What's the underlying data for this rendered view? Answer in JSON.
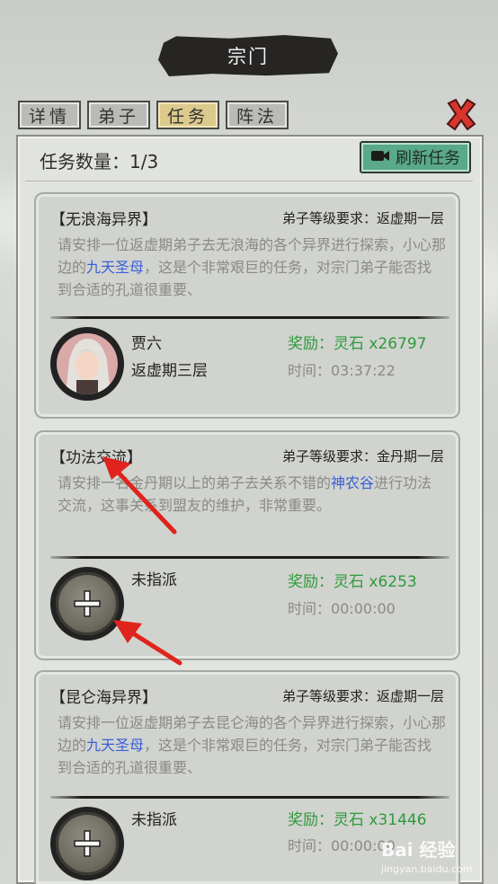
{
  "header": {
    "title": "宗门"
  },
  "tabs": [
    {
      "label": "详情",
      "active": false
    },
    {
      "label": "弟子",
      "active": false
    },
    {
      "label": "任务",
      "active": true
    },
    {
      "label": "阵法",
      "active": false
    }
  ],
  "task_panel": {
    "count_label": "任务数量：1/3",
    "refresh_button": "刷新任务"
  },
  "tasks": [
    {
      "title": "【无浪海异界】",
      "requirement": "弟子等级要求：返虚期一层",
      "desc_before": "请安排一位返虚期弟子去无浪海的各个异界进行探索，小心那边的",
      "desc_highlight": "九天圣母",
      "desc_after": "，这是个非常艰巨的任务，对宗门弟子能否找到合适的孔道很重要、",
      "assignee_name": "贾六",
      "assignee_rank": "返虚期三层",
      "reward": "奖励：灵石 x26797",
      "time": "时间：03:37:22"
    },
    {
      "title": "【功法交流】",
      "requirement": "弟子等级要求：金丹期一层",
      "desc_before": "请安排一名金丹期以上的弟子去关系不错的",
      "desc_highlight": "神农谷",
      "desc_after": "进行功法交流，这事关系到盟友的维护，非常重要。",
      "assignee_name": "未指派",
      "assignee_rank": "",
      "reward": "奖励：灵石 x6253",
      "time": "时间：00:00:00"
    },
    {
      "title": "【昆仑海异界】",
      "requirement": "弟子等级要求：返虚期一层",
      "desc_before": "请安排一位返虚期弟子去昆仑海的各个异界进行探索，小心那边的",
      "desc_highlight": "九天圣母",
      "desc_after": "，这是个非常艰巨的任务，对宗门弟子能否找到合适的孔道很重要、",
      "assignee_name": "未指派",
      "assignee_rank": "",
      "reward": "奖励：灵石 x31446",
      "time": "时间：00:00:00"
    }
  ],
  "watermark": {
    "main": "Bai 经验",
    "sub": "jingyan.baidu.com"
  },
  "colors": {
    "reward_green": "#2f9a3c",
    "highlight_blue": "#3a5fd9",
    "refresh_button": "#5aa98a",
    "active_tab": "#dcc98c"
  }
}
